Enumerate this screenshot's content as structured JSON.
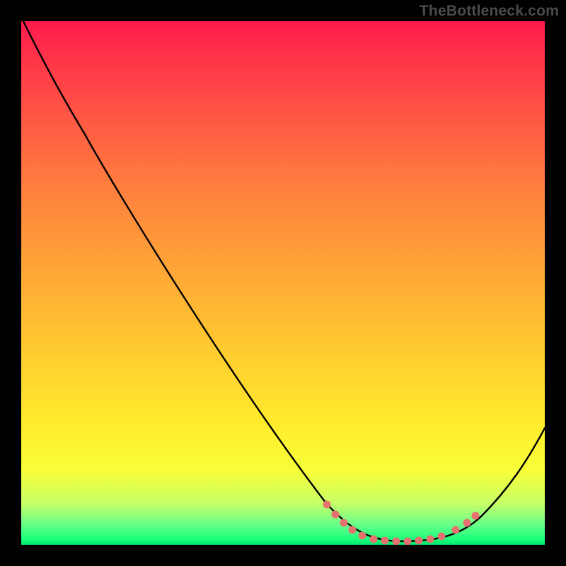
{
  "watermark": "TheBottleneck.com",
  "colors": {
    "frame_background": "#000000",
    "curve": "#000000",
    "optimal_dots": "#e5726e",
    "gradient_top": "#ff1a4d",
    "gradient_bottom": "#00e86e",
    "watermark_text": "#4b4b4b"
  },
  "chart_data": {
    "type": "line",
    "title": "",
    "xlabel": "",
    "ylabel": "",
    "xlim": [
      0,
      100
    ],
    "ylim": [
      0,
      100
    ],
    "description": "Bottleneck-percentage-style curve where y is a mismatch/penalty value over an implied x sweep. Curve falls from ~100 at x=0 to ~0 near x≈72, then rises again toward the right edge. Background vertical rainbow gradient maps high y to red and low y to green. Salmon dots mark the near-optimal band around the minimum.",
    "series": [
      {
        "name": "bottleneck_curve",
        "x": [
          0,
          5,
          10,
          15,
          20,
          25,
          30,
          35,
          40,
          45,
          50,
          55,
          58,
          62,
          66,
          70,
          72,
          74,
          76,
          78,
          80,
          84,
          88,
          92,
          96,
          100
        ],
        "y": [
          101,
          94,
          87,
          80,
          72,
          64,
          56,
          48,
          40,
          32,
          24,
          16,
          10,
          6,
          3,
          1,
          0.5,
          0.5,
          0.5,
          0.7,
          1.2,
          3,
          6,
          11,
          17,
          23
        ]
      },
      {
        "name": "optimal_range_markers",
        "x": [
          58,
          60,
          62,
          63,
          65,
          67,
          69,
          71,
          72,
          74,
          76,
          78,
          80,
          83,
          85,
          87
        ],
        "y": [
          8,
          6,
          4.5,
          3.3,
          2.3,
          1.5,
          1.0,
          0.7,
          0.5,
          0.5,
          0.6,
          0.8,
          1.2,
          2.0,
          3.0,
          4.3
        ]
      }
    ],
    "annotations": []
  }
}
